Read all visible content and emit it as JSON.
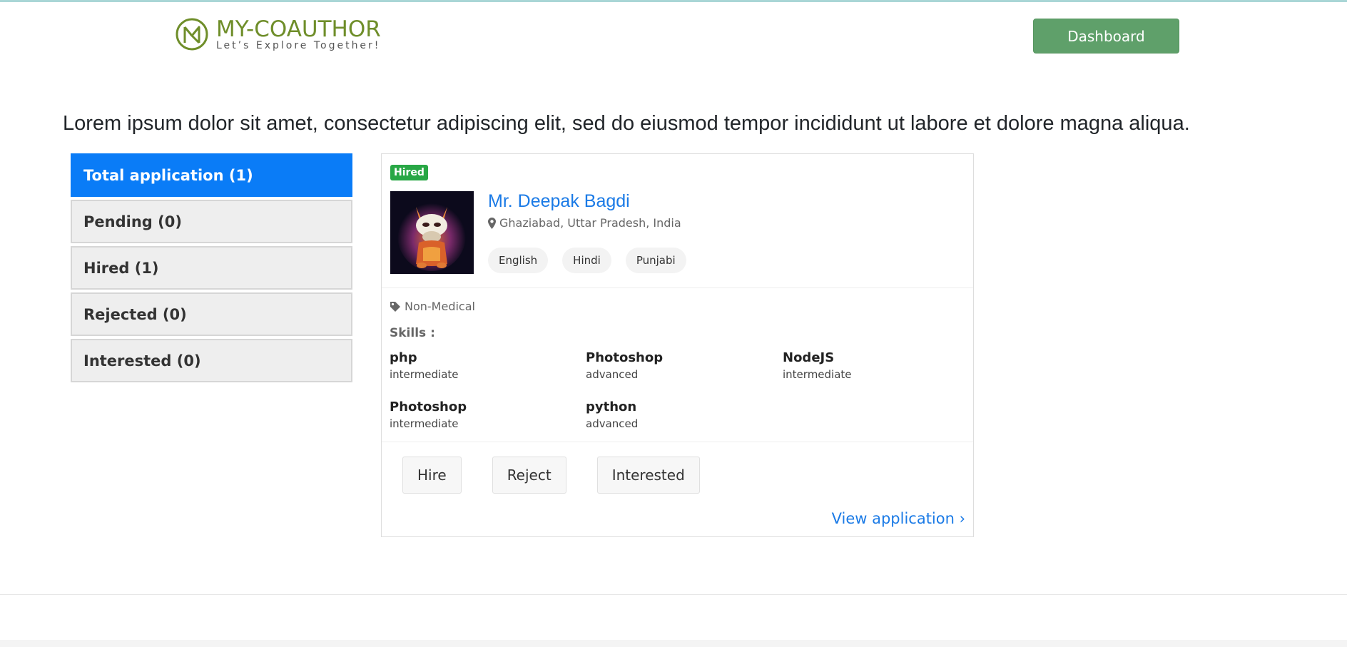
{
  "header": {
    "brand": "MY-COAUTHOR",
    "tagline": "Let’s Explore Together!",
    "dashboard_label": "Dashboard"
  },
  "intro": "Lorem ipsum dolor sit amet, consectetur adipiscing elit, sed do eiusmod tempor incididunt ut labore et dolore magna aliqua.",
  "sidebar": {
    "items": [
      {
        "label": "Total application (1)",
        "active": true
      },
      {
        "label": "Pending (0)",
        "active": false
      },
      {
        "label": "Hired (1)",
        "active": false
      },
      {
        "label": "Rejected (0)",
        "active": false
      },
      {
        "label": "Interested (0)",
        "active": false
      }
    ]
  },
  "application": {
    "status_badge": "Hired",
    "name": "Mr. Deepak Bagdi",
    "location": "Ghaziabad, Uttar Pradesh, India",
    "languages": [
      "English",
      "Hindi",
      "Punjabi"
    ],
    "category": "Non-Medical",
    "skills_title": "Skills :",
    "skills": [
      {
        "name": "php",
        "level": "intermediate"
      },
      {
        "name": "Photoshop",
        "level": "advanced"
      },
      {
        "name": "NodeJS",
        "level": "intermediate"
      },
      {
        "name": "Photoshop",
        "level": "intermediate"
      },
      {
        "name": "python",
        "level": "advanced"
      }
    ],
    "actions": {
      "hire": "Hire",
      "reject": "Reject",
      "interested": "Interested"
    },
    "view_link": "View application ›"
  },
  "colors": {
    "brand": "#6f8e2a",
    "dashboard_button": "#5fa06a",
    "active_tab": "#0a7cf7",
    "badge": "#28a745",
    "link": "#1a7ae6"
  },
  "icons": {
    "logo": "coauthor-logo-icon",
    "location": "map-marker-icon",
    "category": "tag-icon"
  }
}
